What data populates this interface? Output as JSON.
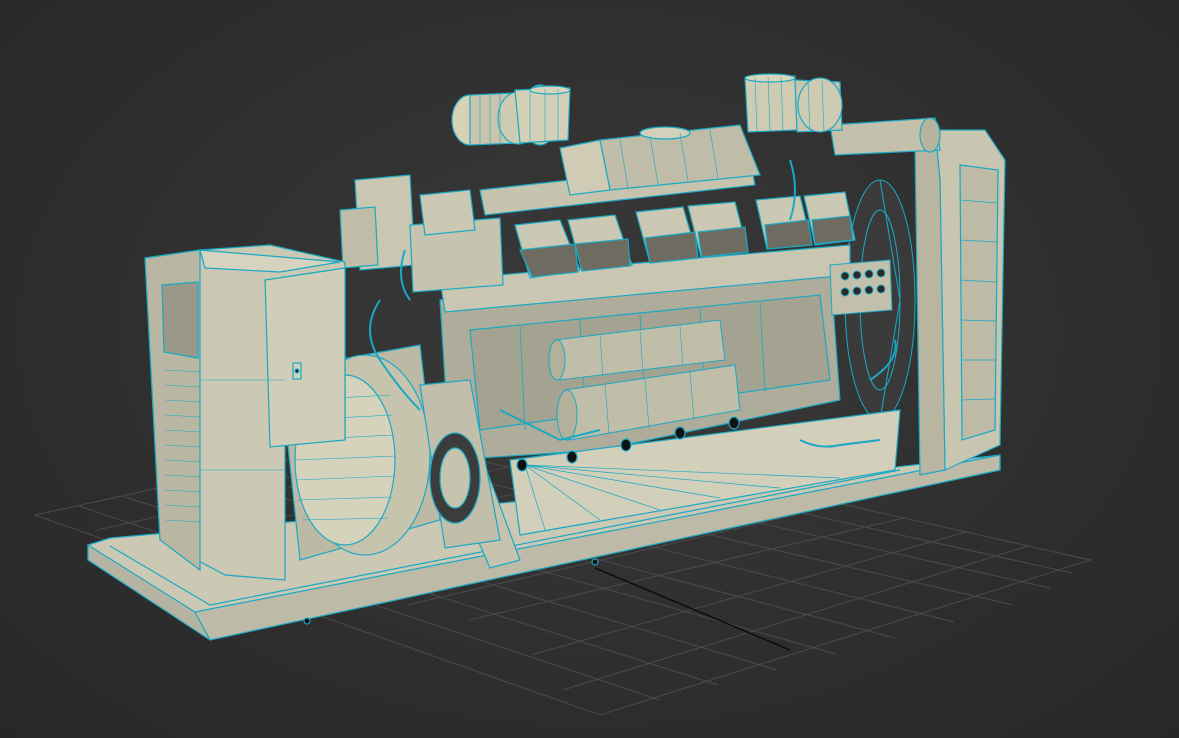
{
  "viewport": {
    "view": "perspective",
    "shading": "wireframe-over-shaded",
    "grid_visible": true
  },
  "colors": {
    "background": "#2f2f2f",
    "grid": "#4a4a4a",
    "axis": "#0e0e0e",
    "model_fill": "#cbc8b4",
    "model_fill_dark": "#9e9c8c",
    "wire": "#1aa9c4"
  },
  "model": {
    "parts": [
      "skid-base",
      "control-panel",
      "alternator",
      "engine-block",
      "cylinder-heads",
      "turbochargers",
      "air-filters",
      "exhaust-manifold",
      "oil-filters",
      "radiator",
      "fan-shroud"
    ]
  }
}
